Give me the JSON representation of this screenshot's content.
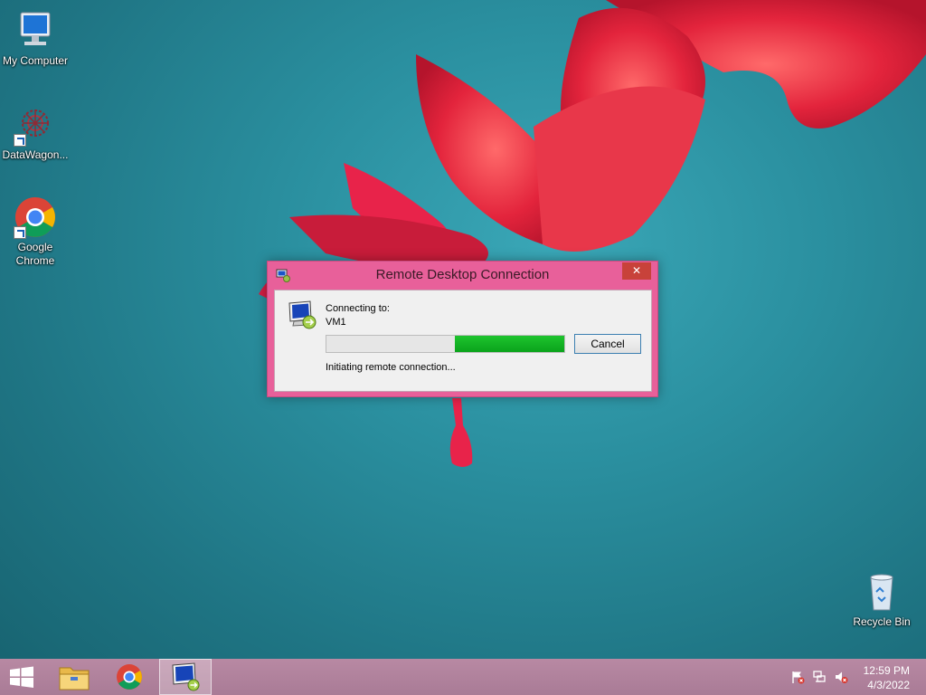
{
  "desktop": {
    "icons": [
      {
        "label": "My Computer"
      },
      {
        "label": "DataWagon..."
      },
      {
        "label": "Google Chrome"
      },
      {
        "label": "Recycle Bin"
      }
    ]
  },
  "dialog": {
    "title": "Remote Desktop Connection",
    "close_label": "✕",
    "connecting_label": "Connecting to:",
    "target": "VM1",
    "status": "Initiating remote connection...",
    "cancel_label": "Cancel",
    "progress_fraction": 0.46
  },
  "taskbar": {
    "items": [
      {
        "icon": "windows-start-icon"
      },
      {
        "icon": "file-explorer-icon"
      },
      {
        "icon": "chrome-icon"
      },
      {
        "icon": "remote-desktop-icon",
        "active": true
      }
    ],
    "tray": {
      "icons": [
        "action-center-flag-icon",
        "network-icon",
        "volume-muted-icon"
      ]
    },
    "time": "12:59 PM",
    "date": "4/3/2022"
  },
  "colors": {
    "dialog_frame": "#e8609a",
    "progress_fill": "#12b424",
    "taskbar": "#b08099"
  }
}
